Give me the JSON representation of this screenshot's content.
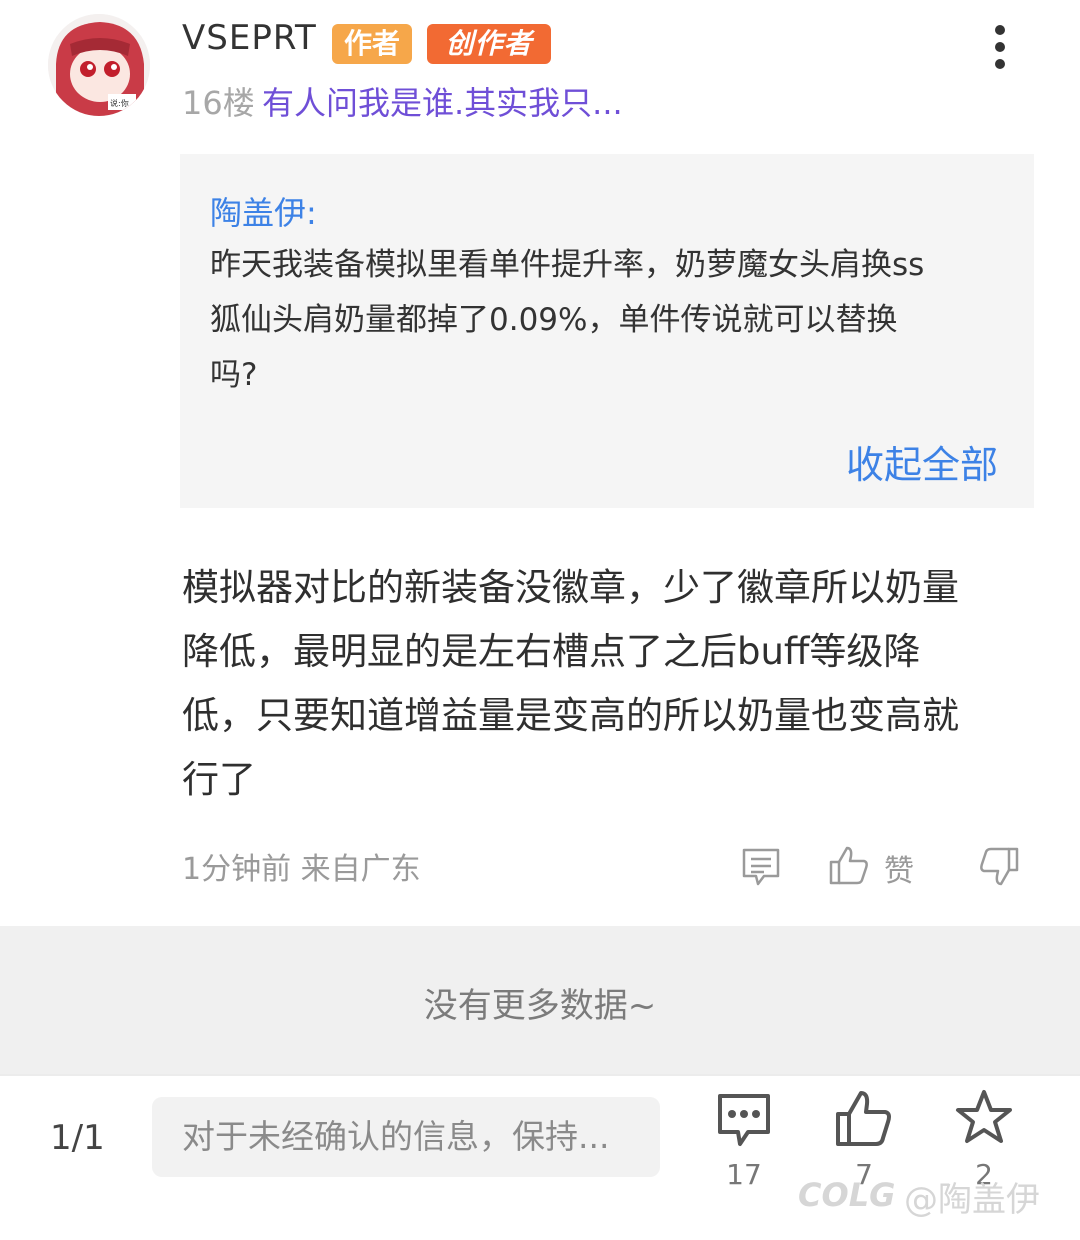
{
  "post": {
    "username": "VSEPRT",
    "badge_author": "作者",
    "badge_creator": "创作者",
    "floor": "16楼",
    "floor_ref": "有人问我是谁.其实我只...",
    "avatar_icon": "anime-avatar",
    "more_icon": "more-vertical-icon"
  },
  "quote": {
    "author": "陶盖伊:",
    "lines": [
      "昨天我装备模拟里看单件提升率，奶萝魔女头肩换ss",
      "狐仙头肩奶量都掉了0.09%，单件传说就可以替换",
      "吗?"
    ],
    "collapse_label": "收起全部"
  },
  "reply": {
    "lines": [
      "模拟器对比的新装备没徽章，少了徽章所以奶量",
      "降低，最明显的是左右槽点了之后buff等级降",
      "低，只要知道增益量是变高的所以奶量也变高就",
      "行了"
    ],
    "meta": "1分钟前 来自广东",
    "like_label": "赞"
  },
  "footer": {
    "no_more": "没有更多数据~"
  },
  "bottom_bar": {
    "page": "1/1",
    "input_placeholder": "对于未经确认的信息，保持...",
    "comment_count": "17",
    "like_count": "7",
    "fav_count": "2"
  },
  "watermark": {
    "logo": "COLG",
    "text": "@陶盖伊"
  },
  "colors": {
    "link_blue": "#3d82e6",
    "floor_purple": "#6f4fd7",
    "badge_author": "#f6a74a",
    "badge_creator": "#f26a33"
  }
}
